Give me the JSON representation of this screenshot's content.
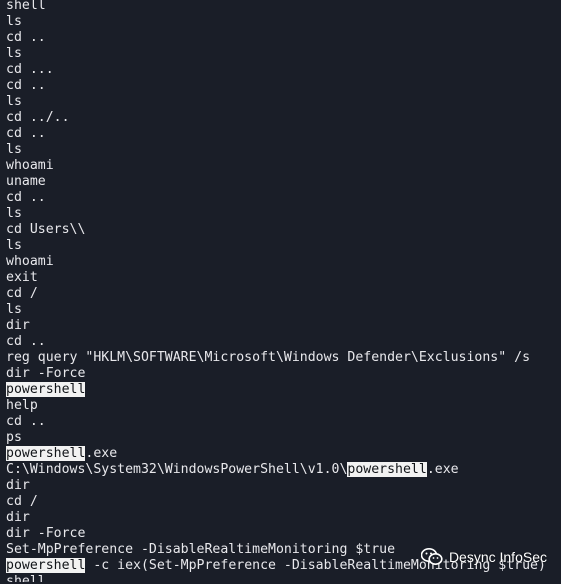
{
  "terminal": {
    "lines": [
      [
        {
          "t": "shell"
        }
      ],
      [
        {
          "t": "ls"
        }
      ],
      [
        {
          "t": "cd .."
        }
      ],
      [
        {
          "t": "ls"
        }
      ],
      [
        {
          "t": "cd ..."
        }
      ],
      [
        {
          "t": "cd .."
        }
      ],
      [
        {
          "t": "ls"
        }
      ],
      [
        {
          "t": "cd ../.."
        }
      ],
      [
        {
          "t": "cd .."
        }
      ],
      [
        {
          "t": "ls"
        }
      ],
      [
        {
          "t": "whoami"
        }
      ],
      [
        {
          "t": "uname"
        }
      ],
      [
        {
          "t": "cd .."
        }
      ],
      [
        {
          "t": "ls"
        }
      ],
      [
        {
          "t": "cd Users\\\\"
        }
      ],
      [
        {
          "t": "ls"
        }
      ],
      [
        {
          "t": "whoami"
        }
      ],
      [
        {
          "t": "exit"
        }
      ],
      [
        {
          "t": "cd /"
        }
      ],
      [
        {
          "t": "ls"
        }
      ],
      [
        {
          "t": "dir"
        }
      ],
      [
        {
          "t": "cd .."
        }
      ],
      [
        {
          "t": "reg query \"HKLM\\SOFTWARE\\Microsoft\\Windows Defender\\Exclusions\" /s"
        }
      ],
      [
        {
          "t": "dir -Force"
        }
      ],
      [
        {
          "t": "powershell",
          "hl": true
        }
      ],
      [
        {
          "t": "help"
        }
      ],
      [
        {
          "t": "cd .."
        }
      ],
      [
        {
          "t": "ps"
        }
      ],
      [
        {
          "t": "powershell",
          "hl": true
        },
        {
          "t": ".exe"
        }
      ],
      [
        {
          "t": "C:\\Windows\\System32\\WindowsPowerShell\\v1.0\\"
        },
        {
          "t": "powershell",
          "hl": true
        },
        {
          "t": ".exe"
        }
      ],
      [
        {
          "t": "dir"
        }
      ],
      [
        {
          "t": "cd /"
        }
      ],
      [
        {
          "t": "dir"
        }
      ],
      [
        {
          "t": "dir -Force"
        }
      ],
      [
        {
          "t": "Set-MpPreference -DisableRealtimeMonitoring $true"
        }
      ],
      [
        {
          "t": "powershell",
          "hl": true
        },
        {
          "t": " -c iex(Set-MpPreference -DisableRealtimeMonitoring $true)"
        }
      ],
      [
        {
          "t": "shell"
        }
      ]
    ]
  },
  "watermark": {
    "text": "Desync InfoSec",
    "icon": "wechat-icon"
  }
}
